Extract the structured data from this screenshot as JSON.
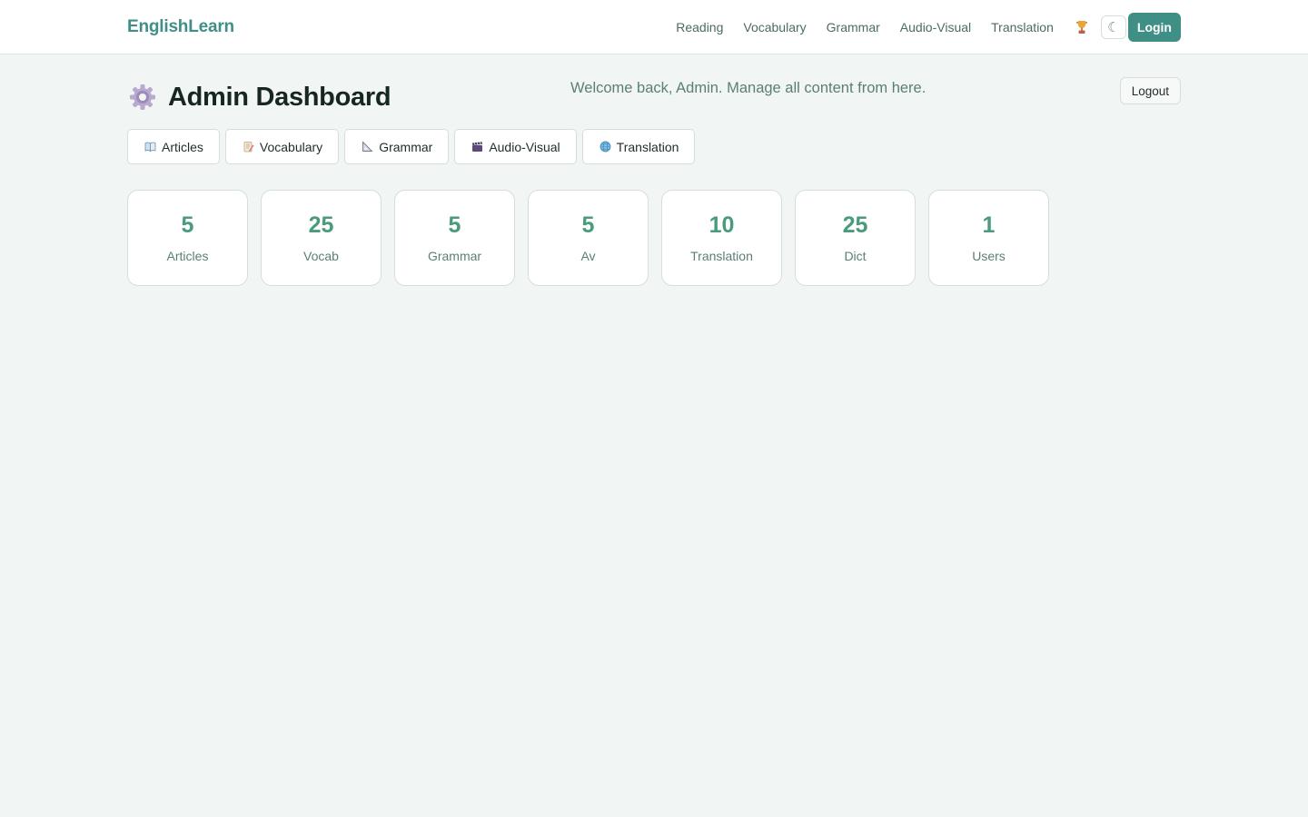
{
  "brand": "EnglishLearn",
  "nav": {
    "links": [
      "Reading",
      "Vocabulary",
      "Grammar",
      "Audio-Visual",
      "Translation"
    ],
    "theme_icon": "☾",
    "login_label": "Login"
  },
  "header": {
    "title": "Admin Dashboard",
    "welcome": "Welcome back, Admin. Manage all content from here.",
    "logout_label": "Logout"
  },
  "tabs": [
    {
      "label": "Articles",
      "icon": "book-icon"
    },
    {
      "label": "Vocabulary",
      "icon": "memo-icon"
    },
    {
      "label": "Grammar",
      "icon": "triangle-ruler-icon"
    },
    {
      "label": "Audio-Visual",
      "icon": "clapper-icon"
    },
    {
      "label": "Translation",
      "icon": "globe-icon"
    }
  ],
  "stats": [
    {
      "value": "5",
      "label": "Articles"
    },
    {
      "value": "25",
      "label": "Vocab"
    },
    {
      "value": "5",
      "label": "Grammar"
    },
    {
      "value": "5",
      "label": "Av"
    },
    {
      "value": "10",
      "label": "Translation"
    },
    {
      "value": "25",
      "label": "Dict"
    },
    {
      "value": "1",
      "label": "Users"
    }
  ],
  "colors": {
    "accent": "#3f8f86",
    "stat_value": "#4a9a7c",
    "background": "#f1f5f4"
  }
}
